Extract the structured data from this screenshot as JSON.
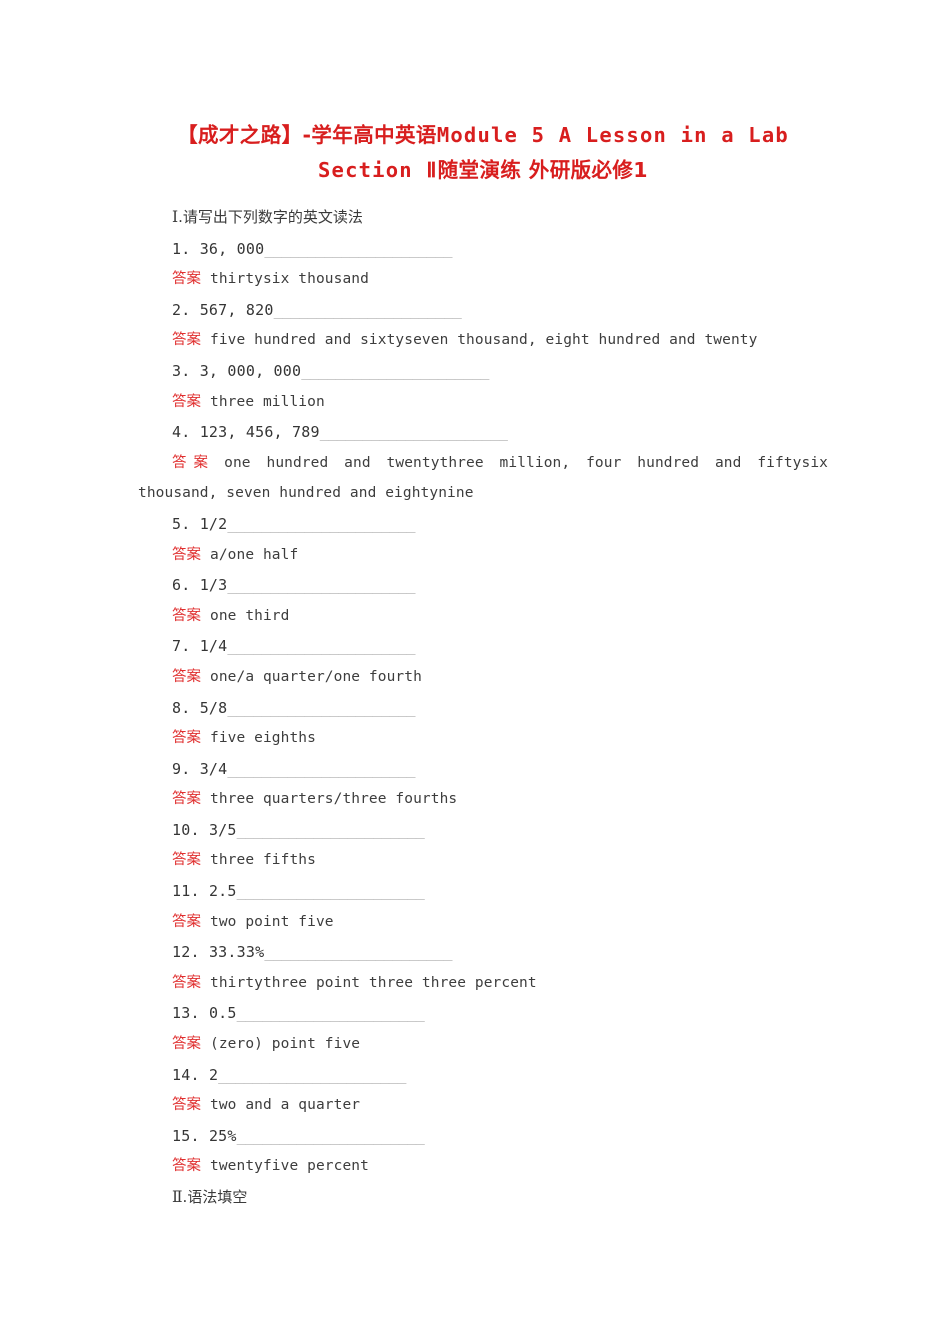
{
  "title": {
    "line1": "【成才之路】-学年高中英语 Module 5 A Lesson in a Lab",
    "line1_cn": "【成才之路】-学年高中英语",
    "line1_lat": "Module 5 A Lesson in a Lab",
    "line2_lat": "Section Ⅱ",
    "line2_cn": "随堂演练 外研版必修1",
    "color": "#d81e1e"
  },
  "answer_label": "答案",
  "answer_label_color": "#e03030",
  "blank_color": "#a8a8a8",
  "sections": [
    {
      "numeral": "Ⅰ",
      "heading": "Ⅰ.请写出下列数字的英文读法",
      "heading_text": ".请写出下列数字的英文读法",
      "items": [
        {
          "number": "1.",
          "prompt": "36, 000",
          "blank": "______________________",
          "answer": "thirtysix thousand",
          "wrapped": false
        },
        {
          "number": "2.",
          "prompt": "567, 820",
          "blank": "______________________",
          "answer": "five hundred and sixtyseven thousand, eight hundred and twenty",
          "wrapped": false
        },
        {
          "number": "3.",
          "prompt": "3, 000, 000",
          "blank": "______________________",
          "answer": "three million",
          "wrapped": false
        },
        {
          "number": "4.",
          "prompt": "123, 456, 789",
          "blank": "______________________",
          "answer": "one hundred and twentythree million, four hundred and fiftysix thousand, seven hundred and eightynine",
          "wrapped": true
        },
        {
          "number": "5.",
          "prompt": "1/2",
          "blank": "______________________",
          "answer": "a/one half",
          "wrapped": false
        },
        {
          "number": "6.",
          "prompt": "1/3",
          "blank": "______________________",
          "answer": "one third",
          "wrapped": false
        },
        {
          "number": "7.",
          "prompt": "1/4",
          "blank": "______________________",
          "answer": "one/a quarter/one fourth",
          "wrapped": false
        },
        {
          "number": "8.",
          "prompt": "5/8",
          "blank": "______________________",
          "answer": "five eighths",
          "wrapped": false
        },
        {
          "number": "9.",
          "prompt": "3/4",
          "blank": "______________________",
          "answer": "three quarters/three fourths",
          "wrapped": false
        },
        {
          "number": "10.",
          "prompt": "3/5",
          "blank": "______________________",
          "answer": "three fifths",
          "wrapped": false
        },
        {
          "number": "11.",
          "prompt": "2.5",
          "blank": "______________________",
          "answer": "two point five",
          "wrapped": false
        },
        {
          "number": "12.",
          "prompt": "33.33%",
          "blank": "______________________",
          "answer": "thirtythree point three three percent",
          "wrapped": false
        },
        {
          "number": "13.",
          "prompt": "0.5",
          "blank": "______________________",
          "answer": "(zero) point five",
          "wrapped": false
        },
        {
          "number": "14.",
          "prompt": "2",
          "blank": "______________________",
          "answer": "two and a quarter",
          "wrapped": false
        },
        {
          "number": "15.",
          "prompt": "25%",
          "blank": "______________________",
          "answer": "twentyfive percent",
          "wrapped": false
        }
      ]
    },
    {
      "numeral": "Ⅱ",
      "heading": "Ⅱ.语法填空",
      "heading_text": ".语法填空",
      "items": []
    }
  ]
}
